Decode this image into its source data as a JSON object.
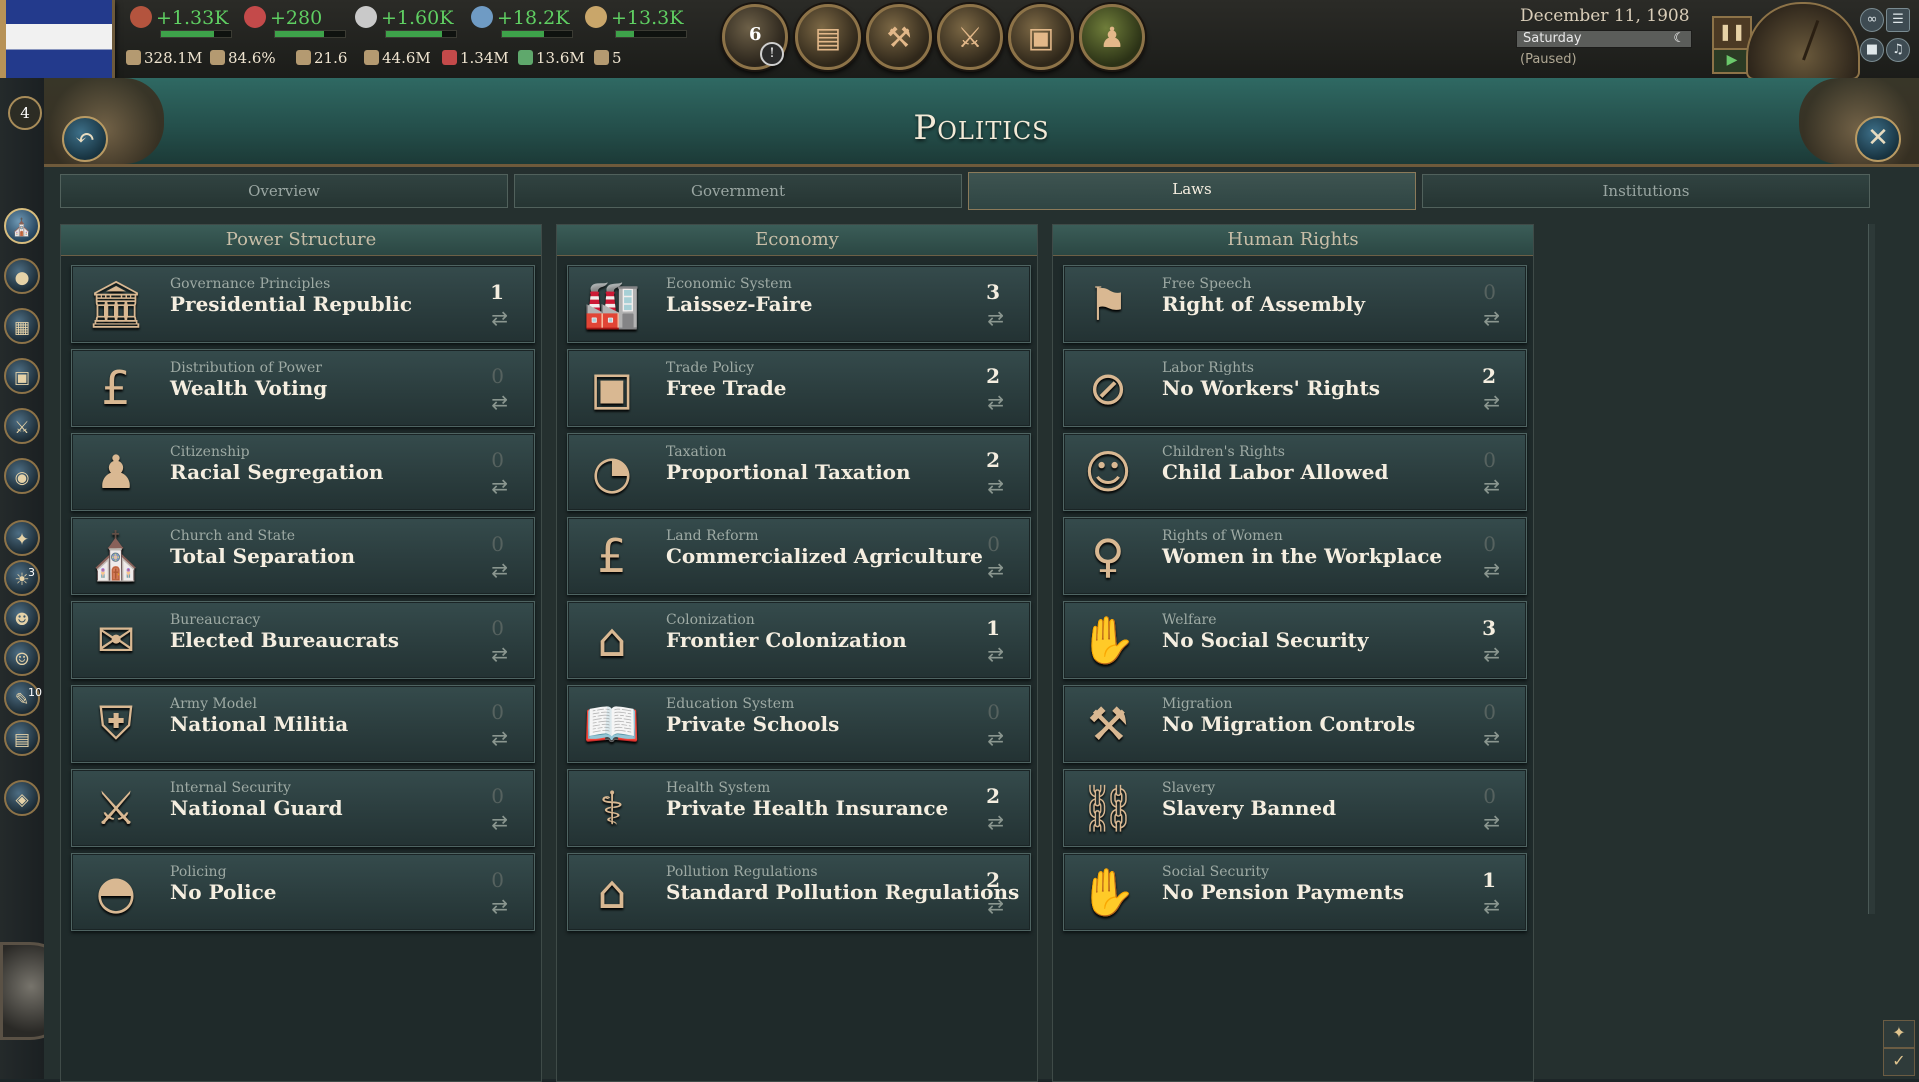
{
  "topbar": {
    "resources": [
      {
        "name": "authority",
        "icon": "crown-icon",
        "value": "+1.33K"
      },
      {
        "name": "influence",
        "icon": "rose-icon",
        "value": "+280"
      },
      {
        "name": "bureaucracy",
        "icon": "dove-icon",
        "value": "+1.60K"
      },
      {
        "name": "trade",
        "icon": "ship-icon",
        "value": "+18.2K"
      },
      {
        "name": "money",
        "icon": "pound-icon",
        "value": "+13.3K"
      }
    ],
    "stats": [
      {
        "icon": "gdp-icon",
        "value": "328.1M"
      },
      {
        "icon": "literacy-icon",
        "value": "84.6%"
      },
      {
        "icon": "sol-icon",
        "value": "21.6"
      },
      {
        "icon": "population-icon",
        "value": "44.6M"
      },
      {
        "icon": "army-icon",
        "value": "1.34M"
      },
      {
        "icon": "loyalty-icon",
        "value": "13.6M"
      },
      {
        "icon": "ships-icon",
        "value": "5"
      }
    ],
    "journal_count": "6",
    "journal_alert": "!",
    "buttons": [
      "radio-icon",
      "hammer-icon",
      "crossed-tools-icon",
      "briefcase-icon",
      "pawn-icon"
    ],
    "date": "December 11, 1908",
    "day": "Saturday",
    "status": "(Paused)"
  },
  "sidebar": {
    "level": "4",
    "badges": {
      "b9": "3",
      "b11": "10"
    }
  },
  "panel": {
    "title": "Politics",
    "tabs": [
      "Overview",
      "Government",
      "Laws",
      "Institutions"
    ],
    "active_tab": "Laws"
  },
  "columns": [
    {
      "title": "Power Structure",
      "laws": [
        {
          "category": "Governance Principles",
          "name": "Presidential Republic",
          "count": "1",
          "icon": "parliament-icon"
        },
        {
          "category": "Distribution of Power",
          "name": "Wealth Voting",
          "count": "0",
          "icon": "pound-icon"
        },
        {
          "category": "Citizenship",
          "name": "Racial Segregation",
          "count": "0",
          "icon": "citizens-icon"
        },
        {
          "category": "Church and State",
          "name": "Total Separation",
          "count": "0",
          "icon": "church-icon"
        },
        {
          "category": "Bureaucracy",
          "name": "Elected Bureaucrats",
          "count": "0",
          "icon": "ballot-icon"
        },
        {
          "category": "Army Model",
          "name": "National Militia",
          "count": "0",
          "icon": "shield-pistol-icon"
        },
        {
          "category": "Internal Security",
          "name": "National Guard",
          "count": "0",
          "icon": "soldiers-icon"
        },
        {
          "category": "Policing",
          "name": "No Police",
          "count": "0",
          "icon": "police-helmet-icon"
        }
      ]
    },
    {
      "title": "Economy",
      "laws": [
        {
          "category": "Economic System",
          "name": "Laissez-Faire",
          "count": "3",
          "icon": "factory-icon"
        },
        {
          "category": "Trade Policy",
          "name": "Free Trade",
          "count": "2",
          "icon": "crate-icon"
        },
        {
          "category": "Taxation",
          "name": "Proportional Taxation",
          "count": "2",
          "icon": "pie-icon"
        },
        {
          "category": "Land Reform",
          "name": "Commercialized Agriculture",
          "count": "0",
          "icon": "money-bag-icon"
        },
        {
          "category": "Colonization",
          "name": "Frontier Colonization",
          "count": "1",
          "icon": "house-icon"
        },
        {
          "category": "Education System",
          "name": "Private Schools",
          "count": "0",
          "icon": "book-icon"
        },
        {
          "category": "Health System",
          "name": "Private Health Insurance",
          "count": "2",
          "icon": "syringe-icon"
        },
        {
          "category": "Pollution Regulations",
          "name": "Standard Pollution Regulations",
          "count": "2",
          "icon": "house-icon"
        }
      ]
    },
    {
      "title": "Human Rights",
      "laws": [
        {
          "category": "Free Speech",
          "name": "Right of Assembly",
          "count": "0",
          "icon": "banners-icon"
        },
        {
          "category": "Labor Rights",
          "name": "No Workers' Rights",
          "count": "2",
          "icon": "no-workers-icon"
        },
        {
          "category": "Children's Rights",
          "name": "Child Labor Allowed",
          "count": "0",
          "icon": "child-icon"
        },
        {
          "category": "Rights of Women",
          "name": "Women in the Workplace",
          "count": "0",
          "icon": "female-factory-icon"
        },
        {
          "category": "Welfare",
          "name": "No Social Security",
          "count": "3",
          "icon": "hands-icon"
        },
        {
          "category": "Migration",
          "name": "No Migration Controls",
          "count": "0",
          "icon": "migrant-icon"
        },
        {
          "category": "Slavery",
          "name": "Slavery Banned",
          "count": "0",
          "icon": "broken-chain-icon"
        },
        {
          "category": "Social Security",
          "name": "No Pension Payments",
          "count": "1",
          "icon": "hands-icon"
        }
      ]
    }
  ]
}
